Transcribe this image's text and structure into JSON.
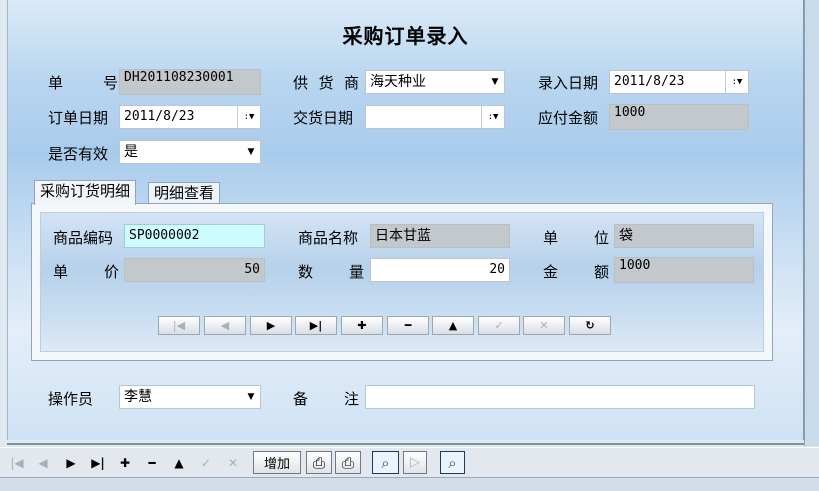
{
  "form": {
    "title": "采购订单录入",
    "order_no": {
      "label": "单　号",
      "value": "DH201108230001"
    },
    "supplier": {
      "label": "供货商",
      "value": "海天种业"
    },
    "entry_date": {
      "label": "录入日期",
      "value": "2011/8/23"
    },
    "order_date": {
      "label": "订单日期",
      "value": "2011/8/23"
    },
    "delivery_date": {
      "label": "交货日期",
      "value": ""
    },
    "payable_amount": {
      "label": "应付金额",
      "value": "1000"
    },
    "is_valid": {
      "label": "是否有效",
      "value": "是"
    },
    "operator": {
      "label": "操作员",
      "value": "李慧"
    },
    "remark": {
      "label": "备　注",
      "value": ""
    }
  },
  "tabs": [
    {
      "label": "采购订货明细",
      "active": true
    },
    {
      "label": "明细查看",
      "active": false
    }
  ],
  "detail": {
    "product_code": {
      "label": "商品编码",
      "value": "SP0000002"
    },
    "product_name": {
      "label": "商品名称",
      "value": "日本甘蓝"
    },
    "unit": {
      "label": "单　位",
      "value": "袋"
    },
    "price": {
      "label": "单　价",
      "value": "50"
    },
    "quantity": {
      "label": "数　量",
      "value": "20"
    },
    "amount": {
      "label": "金　额",
      "value": "1000"
    }
  },
  "toolbar": {
    "add_label": "增加"
  },
  "icons": {
    "first": "first-record-icon",
    "prev": "prev-record-icon",
    "next": "next-record-icon",
    "last": "last-record-icon",
    "add": "plus-icon",
    "delete": "minus-icon",
    "edit": "edit-icon",
    "save": "check-icon",
    "cancel": "cancel-icon",
    "refresh": "refresh-icon"
  }
}
